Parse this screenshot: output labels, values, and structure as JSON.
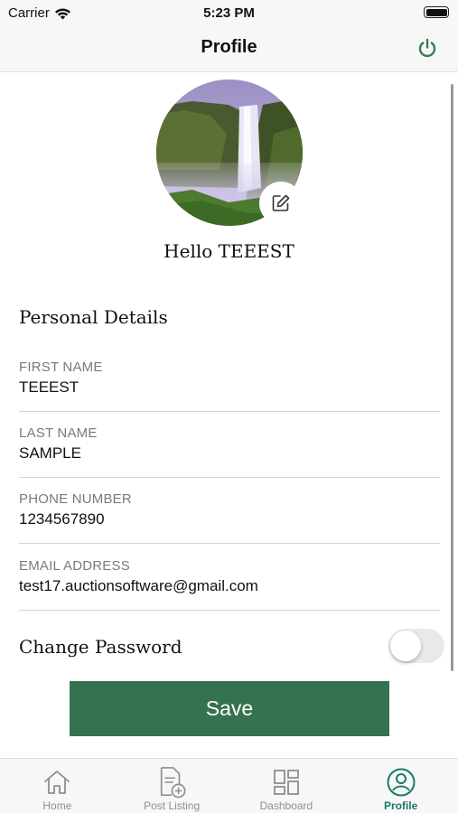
{
  "status_bar": {
    "carrier": "Carrier",
    "time": "5:23 PM",
    "battery_level": 1.0
  },
  "nav": {
    "title": "Profile",
    "power_icon": "power-icon",
    "accent_color": "#3a7a52"
  },
  "profile": {
    "avatar_icon": "waterfall-photo",
    "edit_icon": "edit-icon",
    "greeting": "Hello TEEEST"
  },
  "personal_details": {
    "title": "Personal Details",
    "fields": [
      {
        "label": "FIRST NAME",
        "value": "TEEEST"
      },
      {
        "label": "LAST NAME",
        "value": "SAMPLE"
      },
      {
        "label": "PHONE NUMBER",
        "value": "1234567890"
      },
      {
        "label": "EMAIL ADDRESS",
        "value": "test17.auctionsoftware@gmail.com"
      }
    ]
  },
  "change_password": {
    "label": "Change Password",
    "enabled": false
  },
  "save": {
    "label": "Save",
    "color": "#35734f"
  },
  "tabs": [
    {
      "label": "Home",
      "icon": "home-icon",
      "active": false
    },
    {
      "label": "Post Listing",
      "icon": "post-listing-icon",
      "active": false
    },
    {
      "label": "Dashboard",
      "icon": "dashboard-icon",
      "active": false
    },
    {
      "label": "Profile",
      "icon": "profile-icon",
      "active": true
    }
  ],
  "colors": {
    "active_tab": "#1a7a66",
    "inactive_tab": "#8e8e8e"
  }
}
